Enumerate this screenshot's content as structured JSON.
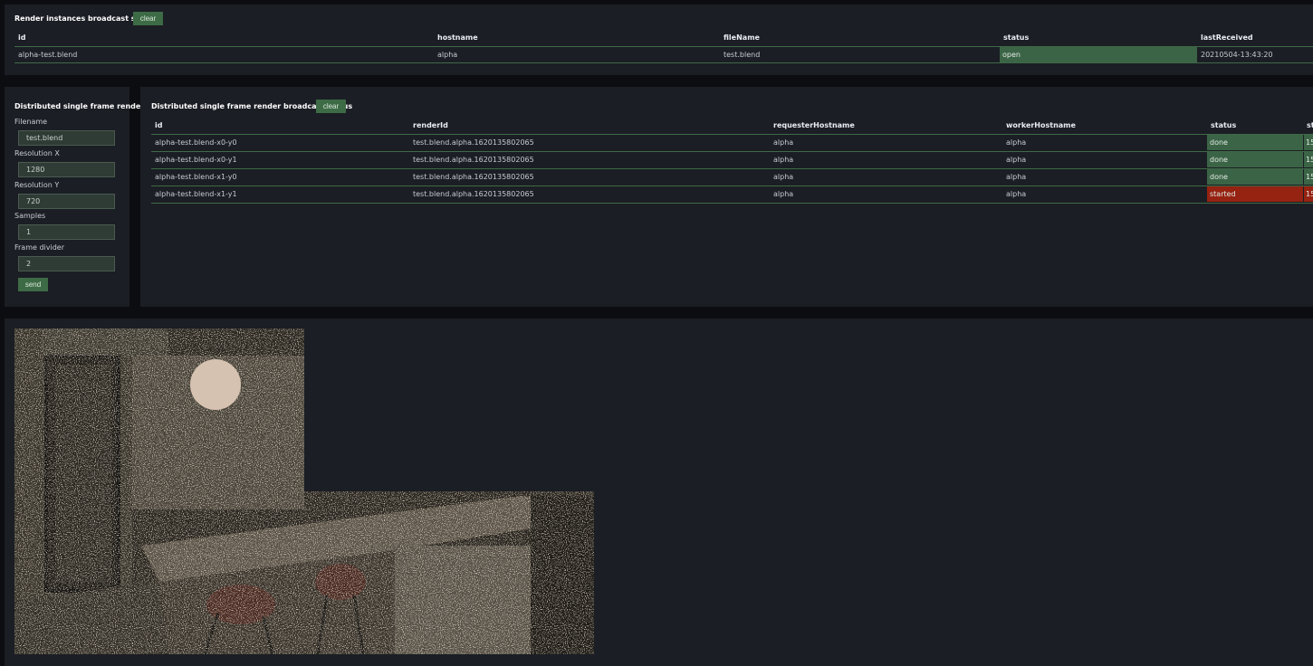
{
  "colors": {
    "page_bg": "#0c0d10",
    "panel_bg": "#1b1e24",
    "accent_green": "#3d6b45",
    "status_done": "#3b6446",
    "status_started": "#962212"
  },
  "instances": {
    "title": "Render instances broadcast status",
    "clear_label": "clear",
    "columns": [
      "id",
      "hostname",
      "fileName",
      "status",
      "lastReceived"
    ],
    "rows": [
      {
        "id": "alpha-test.blend",
        "hostname": "alpha",
        "fileName": "test.blend",
        "status": "open",
        "lastReceived": "20210504-13:43:20"
      }
    ]
  },
  "form": {
    "title": "Distributed single frame render",
    "filename_label": "Filename",
    "filename_value": "test.blend",
    "res_x_label": "Resolution X",
    "res_x_value": "1280",
    "res_y_label": "Resolution Y",
    "res_y_value": "720",
    "samples_label": "Samples",
    "samples_value": "1",
    "divider_label": "Frame divider",
    "divider_value": "2",
    "send_label": "send"
  },
  "frames": {
    "title": "Distributed single frame render broadcast status",
    "clear_label": "clear",
    "columns": [
      "id",
      "renderId",
      "requesterHostname",
      "workerHostname",
      "status",
      "st"
    ],
    "rows": [
      {
        "id": "alpha-test.blend-x0-y0",
        "renderId": "test.blend.alpha.1620135802065",
        "requester": "alpha",
        "worker": "alpha",
        "status": "done",
        "extra": "15"
      },
      {
        "id": "alpha-test.blend-x0-y1",
        "renderId": "test.blend.alpha.1620135802065",
        "requester": "alpha",
        "worker": "alpha",
        "status": "done",
        "extra": "15"
      },
      {
        "id": "alpha-test.blend-x1-y0",
        "renderId": "test.blend.alpha.1620135802065",
        "requester": "alpha",
        "worker": "alpha",
        "status": "done",
        "extra": "15"
      },
      {
        "id": "alpha-test.blend-x1-y1",
        "renderId": "test.blend.alpha.1620135802065",
        "requester": "alpha",
        "worker": "alpha",
        "status": "started",
        "extra": "15"
      }
    ]
  }
}
